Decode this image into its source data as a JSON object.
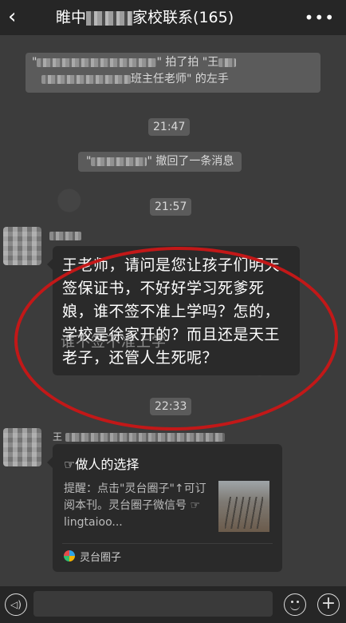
{
  "header": {
    "back_icon": "chevron-left-icon",
    "title_prefix": "睢中",
    "title_suffix": "家校联系",
    "member_count": "(165)",
    "more_icon": "more-dots-icon"
  },
  "messages": {
    "pat_notice": {
      "verb": "\" 拍了拍 \"王",
      "tail": "班主任老师\" 的左手"
    },
    "time_1": "21:47",
    "recall_notice": {
      "text": "\" 撤回了一条消息"
    },
    "time_2": "21:57",
    "highlighted_message": {
      "text": "王老师，请问是您让孩子们明天签保证书，不好好学习死爹死娘，谁不签不准上学吗？怎的，学校是徐家开的？而且还是天王老子，还管人生死呢？",
      "overlay": "谁不签不准上学"
    },
    "time_3": "22:33",
    "article_card": {
      "sender_prefix": "王",
      "title": "☞做人的选择",
      "description": "提醒：点击\"灵台圈子\"↑可订阅本刊。灵台圈子微信号 ☞ lingtaioo...",
      "source": "灵台圈子"
    }
  },
  "bottom": {
    "voice_icon": "voice-icon",
    "voice_glyph": "◁)",
    "emoji_icon": "emoji-icon",
    "plus_icon": "plus-icon",
    "plus_glyph": "+"
  }
}
